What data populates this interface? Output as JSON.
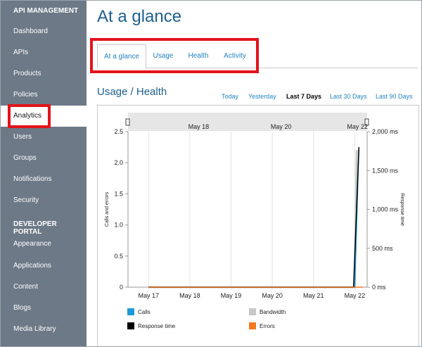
{
  "sidebar": {
    "api_heading": "API MANAGEMENT",
    "api_items": [
      "Dashboard",
      "APIs",
      "Products",
      "Policies",
      "Analytics",
      "Users",
      "Groups",
      "Notifications",
      "Security"
    ],
    "dev_heading": "DEVELOPER PORTAL",
    "dev_items": [
      "Appearance",
      "Applications",
      "Content",
      "Blogs",
      "Media Library"
    ],
    "active_item": "Analytics"
  },
  "main": {
    "title": "At a glance",
    "tabs": [
      "At a glance",
      "Usage",
      "Health",
      "Activity"
    ],
    "active_tab": "At a glance",
    "section_title": "Usage / Health",
    "ranges": [
      "Today",
      "Yesterday",
      "Last 7 Days",
      "Last 30 Days",
      "Last 90 Days"
    ],
    "selected_range": "Last 7 Days"
  },
  "colors": {
    "sidebar_bg": "#6d7987",
    "highlight_red": "#e3141b",
    "link_blue": "#1e84c4",
    "title_blue": "#1d5f8e"
  },
  "chart_data": {
    "type": "line",
    "navigator_labels": [
      "May 18",
      "May 20",
      "May 22"
    ],
    "x_categories": [
      "May 17",
      "May 18",
      "May 19",
      "May 20",
      "May 21",
      "May 22"
    ],
    "ylabel": "Calls and errors",
    "y2label": "Response time",
    "y_ticks": [
      "0",
      "0.5",
      "1.0",
      "1.5",
      "2.0",
      "2.5"
    ],
    "y_range": [
      0,
      2.5
    ],
    "y2_ticks": [
      "0 ms",
      "500 ms",
      "1,000 ms",
      "1,500 ms",
      "2,000 ms"
    ],
    "y2_range": [
      0,
      2000
    ],
    "grid": true,
    "legend_position": "bottom",
    "series": [
      {
        "name": "Calls",
        "color": "#1e9bd7",
        "points": [
          [
            0,
            0
          ],
          [
            5.0,
            0
          ],
          [
            5.1,
            2.25
          ]
        ]
      },
      {
        "name": "Bandwidth",
        "color": "#c8c8c8",
        "points": [
          [
            0,
            0
          ],
          [
            5.0,
            0
          ],
          [
            5.05,
            2.2
          ]
        ]
      },
      {
        "name": "Response time",
        "color": "#000000",
        "points": [
          [
            0,
            0
          ],
          [
            4.97,
            0
          ],
          [
            5.03,
            1.0
          ],
          [
            5.1,
            1800
          ]
        ]
      },
      {
        "name": "Errors",
        "color": "#f47920",
        "points": [
          [
            0,
            0
          ],
          [
            5.2,
            0
          ]
        ]
      }
    ]
  }
}
